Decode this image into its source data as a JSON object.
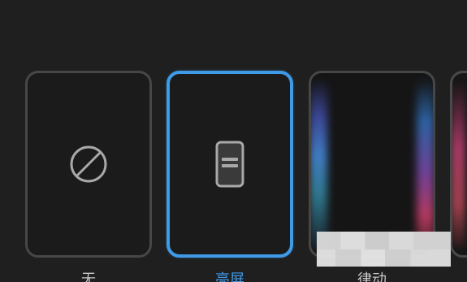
{
  "options": [
    {
      "id": "none",
      "label": "无",
      "selected": false,
      "icon": "prohibited-icon"
    },
    {
      "id": "lockscreen",
      "label": "亮屏",
      "selected": true,
      "icon": "phone-lockscreen-icon"
    },
    {
      "id": "dynamic",
      "label": "律动",
      "selected": false,
      "icon": "edge-glow-preview"
    }
  ],
  "colors": {
    "background": "#1f1f1f",
    "accent": "#3f9ae8",
    "card_border": "#474747",
    "label": "#c8c8c8"
  }
}
